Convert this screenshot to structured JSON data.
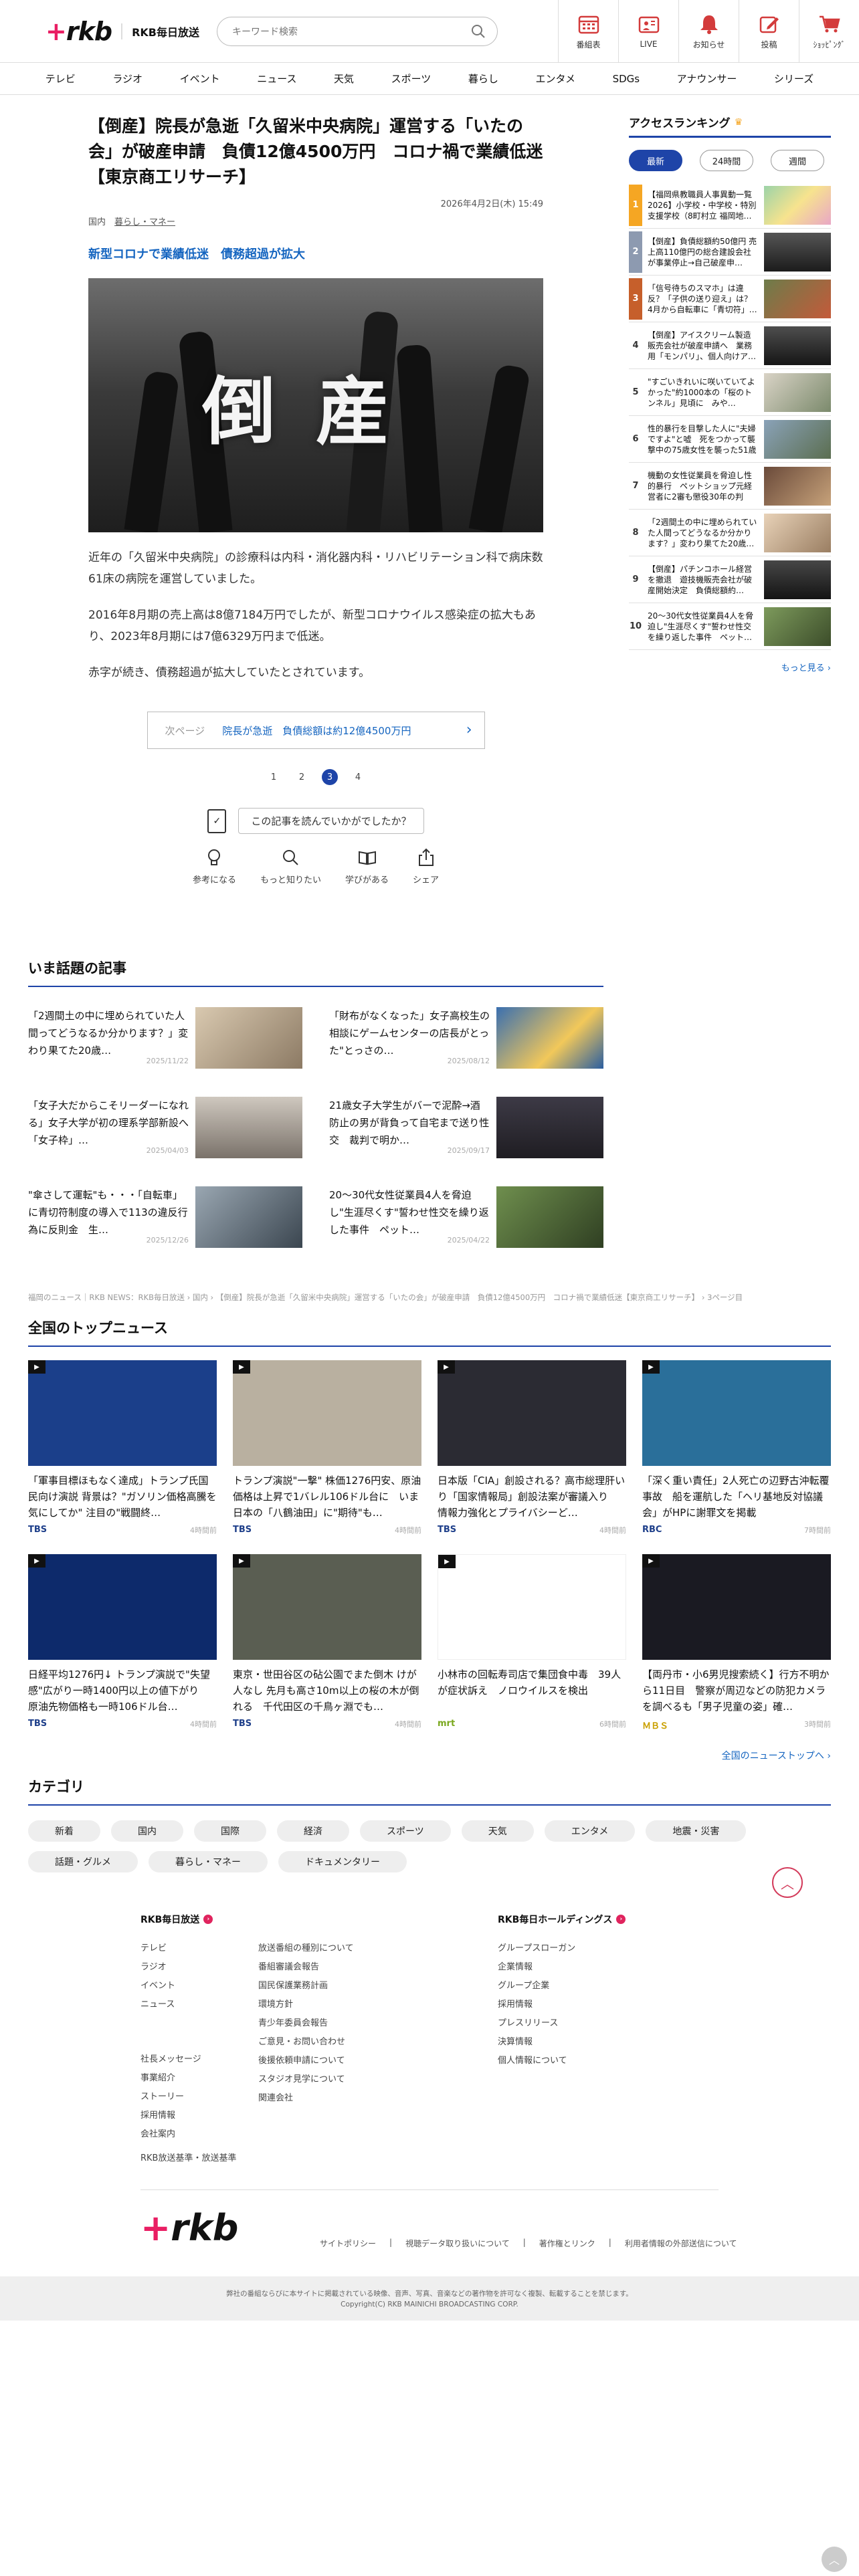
{
  "header": {
    "site_name": "RKB毎日放送",
    "search_placeholder": "キーワード検索",
    "icons": [
      {
        "label": "番組表",
        "icon": "calendar-icon"
      },
      {
        "label": "LIVE",
        "icon": "live-tv-icon"
      },
      {
        "label": "お知らせ",
        "icon": "bell-icon"
      },
      {
        "label": "投稿",
        "icon": "pencil-icon"
      },
      {
        "label": "ｼｮｯﾋﾟﾝｸﾞ",
        "icon": "cart-icon"
      }
    ]
  },
  "nav": [
    "テレビ",
    "ラジオ",
    "イベント",
    "ニュース",
    "天気",
    "スポーツ",
    "暮らし",
    "エンタメ",
    "SDGs",
    "アナウンサー",
    "シリーズ"
  ],
  "article": {
    "title": "【倒産】院長が急逝「久留米中央病院」運営する「いたの会」が破産申請　負債12億4500万円　コロナ禍で業績低迷【東京商工リサーチ】",
    "date": "2026年4月2日(木) 15:49",
    "cat1": "国内",
    "cat2": "暮らし・マネー",
    "subtitle": "新型コロナで業績低迷　債務超過が拡大",
    "hero_text": "倒産",
    "p1": "近年の「久留米中央病院」の診療科は内科・消化器内科・リハビリテーション科で病床数61床の病院を運営していました。",
    "p2": "2016年8月期の売上高は8億7184万円でしたが、新型コロナウイルス感染症の拡大もあり、2023年8月期には7億6329万円まで低迷。",
    "p3": "赤字が続き、債務超過が拡大していたとされています。",
    "next_label": "次ページ",
    "next_title": "院長が急逝　負債総額は約12億4500万円",
    "pages": [
      "1",
      "2",
      "3",
      "4"
    ],
    "current_page": "3",
    "feedback_q": "この記事を読んでいかがでしたか？",
    "reactions": [
      {
        "label": "参考になる",
        "icon": "lightbulb-icon"
      },
      {
        "label": "もっと知りたい",
        "icon": "magnifier-icon"
      },
      {
        "label": "学びがある",
        "icon": "book-icon"
      },
      {
        "label": "シェア",
        "icon": "share-icon"
      }
    ]
  },
  "ranking": {
    "title": "アクセスランキング",
    "tabs": [
      "最新",
      "24時間",
      "週間"
    ],
    "items": [
      {
        "n": "1",
        "t": "【福岡県教職員人事異動一覧2026】小学校・中学校・特別支援学校（8町村立 福岡地…"
      },
      {
        "n": "2",
        "t": "【倒産】負債総額約50億円 売上高110億円の総合建設会社が事業停止→自己破産申…"
      },
      {
        "n": "3",
        "t": "「信号待ちのスマホ」は違反？「子供の送り迎え」は？　4月から自転車に「青切符」…"
      },
      {
        "n": "4",
        "t": "【倒産】アイスクリーム製造販売会社が破産申請へ　業務用「モンパリ」、個人向けア…"
      },
      {
        "n": "5",
        "t": "\"すごいきれいに咲いていてよかった\"約1000本の「桜のトンネル」見頃に　みや…"
      },
      {
        "n": "6",
        "t": "性的暴行を目撃した人に\"夫婦ですよ\"と嘘　死をつかって襲撃中の75歳女性を襲った51歳男…"
      },
      {
        "n": "7",
        "t": "機動の女性従業員を脅迫し性的暴行　ペットショップ元経営者に2審も懲役30年の判決…"
      },
      {
        "n": "8",
        "t": "「2週間土の中に埋められていた人間ってどうなるか分かります？」変わり果てた20歳…"
      },
      {
        "n": "9",
        "t": "【倒産】パチンコホール経営を撤退　遊技機販売会社が破産開始決定　負債総額約…"
      },
      {
        "n": "10",
        "t": "20〜30代女性従業員4人を脅迫し\"生涯尽くす\"誓わせ性交を繰り返した事件　ペット…"
      }
    ],
    "more": "もっと見る"
  },
  "wadai": {
    "title": "いま話題の記事",
    "items": [
      {
        "t": "「2週間土の中に埋められていた人間ってどうなるか分かります？」変わり果てた20歳…",
        "d": "2025/11/22"
      },
      {
        "t": "「財布がなくなった」女子高校生の相談にゲームセンターの店長がとった\"とっさの…",
        "d": "2025/08/12"
      },
      {
        "t": "「女子大だからこそリーダーになれる」女子大学が初の理系学部新設へ「女子枠」…",
        "d": "2025/04/03"
      },
      {
        "t": "21歳女子大学生がバーで泥酔→酒防止の男が背負って自宅まで送り性交　裁判で明か…",
        "d": "2025/09/17"
      },
      {
        "t": "\"傘さして運転\"も・・・「自転車」に青切符制度の導入で113の違反行為に反則金　生…",
        "d": "2025/12/26"
      },
      {
        "t": "20〜30代女性従業員4人を脅迫し\"生涯尽くす\"誓わせ性交を繰り返した事件　ペット…",
        "d": "2025/04/22"
      }
    ]
  },
  "breadcrumb": "福岡のニュース｜RKB NEWS：RKB毎日放送 › 国内 › 【倒産】院長が急逝「久留米中央病院」運営する「いたの会」が破産申請　負債12億4500万円　コロナ禍で業績低迷【東京商工リサーチ】 › 3ページ目",
  "topnews": {
    "title": "全国のトップニュース",
    "items": [
      {
        "t": "「軍事目標ほもなく達成」トランプ氏国民向け演説 背景は？\"ガソリン価格高騰を気にしてか\" 注目の\"戦闘終…",
        "src": "TBS",
        "time": "4時間前",
        "c": "#1b3f8a"
      },
      {
        "t": "トランプ演説\"一撃\" 株価1276円安、原油価格は上昇で1バレル106ドル台に　いま日本の「八鶴油田」に\"期待\"も…",
        "src": "TBS",
        "time": "4時間前",
        "c": "#b9b0a0"
      },
      {
        "t": "日本版「CIA」創設される？高市総理肝いり「国家情報局」創設法案が審議入り　情報力強化とプライバシーど…",
        "src": "TBS",
        "time": "4時間前",
        "c": "#2b2b33"
      },
      {
        "t": "「深く重い責任」2人死亡の辺野古沖転覆事故　船を運航した「ヘリ基地反対協議会」がHPに謝罪文を掲載",
        "src": "RBC",
        "time": "7時間前",
        "c": "#2a6f9a"
      },
      {
        "t": "日経平均1276円↓ トランプ演説で\"失望感\"広がり一時1400円以上の値下がり　原油先物価格も一時106ドル台…",
        "src": "TBS",
        "time": "4時間前",
        "c": "#0d2a6b"
      },
      {
        "t": "東京・世田谷区の砧公園でまた倒木 けが人なし 先月も高さ10m以上の桜の木が倒れる　千代田区の千鳥ヶ淵でも…",
        "src": "TBS",
        "time": "4時間前",
        "c": "#5a5e52"
      },
      {
        "t": "小林市の回転寿司店で集団食中毒　39人が症状訴え　ノロウイルスを検出",
        "src": "mrt",
        "time": "6時間前",
        "c": "#ffffff"
      },
      {
        "t": "【両丹市・小6男児搜索続く】行方不明から11日目　警察が周辺などの防犯カメラを調べるも「男子児童の姿」確…",
        "src": "ＭＢＳ",
        "time": "3時間前",
        "c": "#1a1a22"
      }
    ],
    "all": "全国のニューストップへ"
  },
  "category": {
    "title": "カテゴリ",
    "chips": [
      "新着",
      "国内",
      "国際",
      "経済",
      "スポーツ",
      "天気",
      "エンタメ",
      "地震・災害",
      "話題・グルメ",
      "暮らし・マネー",
      "ドキュメンタリー"
    ]
  },
  "footer": {
    "col1_title": "RKB毎日放送",
    "col1a": [
      "テレビ",
      "ラジオ",
      "イベント",
      "ニュース"
    ],
    "col1b": [
      "社長メッセージ",
      "事業紹介",
      "ストーリー",
      "採用情報",
      "会社案内"
    ],
    "col1c": "RKB放送基準・放送基準",
    "col2": [
      "放送番組の種別について",
      "番組審議会報告",
      "国民保護業務計画",
      "環境方針",
      "青少年委員会報告",
      "ご意見・お問い合わせ",
      "後援依頼申請について",
      "スタジオ見学について",
      "関連会社"
    ],
    "col3_title": "RKB毎日ホールディングス",
    "col3": [
      "グループスローガン",
      "企業情報",
      "グループ企業",
      "採用情報",
      "プレスリリース",
      "決算情報",
      "個人情報について"
    ],
    "links": [
      "サイトポリシー",
      "視聴データ取り扱いについて",
      "著作権とリンク",
      "利用者情報の外部送信について"
    ],
    "notice": "弊社の番組ならびに本サイトに掲載されている映像、音声、写真、音楽などの著作物を許可なく複製、転載することを禁じます。",
    "copyright": "Copyright(C) RKB MAINICHI BROADCASTING CORP."
  }
}
